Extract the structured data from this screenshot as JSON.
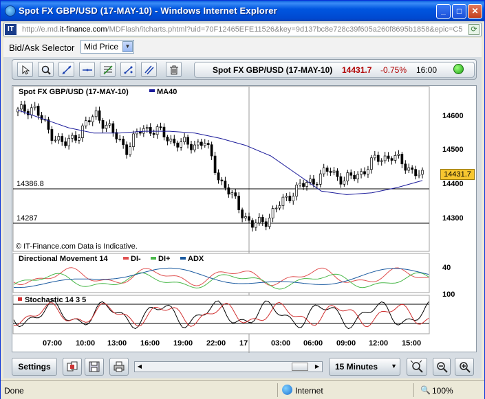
{
  "window": {
    "title": "Spot FX GBP/USD (17-MAY-10) - Windows Internet Explorer",
    "address_host_prefix": "http://e.md.",
    "address_host": "it-finance.com",
    "address_rest": "/MDFlash/itcharts.phtml?uid=70F12465EFE11526&key=9d137bc8e728c39f605a260f8695b1858&epic=C5.t",
    "site_icon_text": "IT"
  },
  "selector": {
    "label": "Bid/Ask Selector",
    "value": "Mid Price"
  },
  "quote": {
    "name": "Spot FX GBP/USD (17-MAY-10)",
    "price": "14431.7",
    "change": "-0.75%",
    "time": "16:00",
    "price_color": "#b00000",
    "change_color": "#b00000"
  },
  "chart": {
    "main_title": "Spot FX GBP/USD (17-MAY-10)",
    "ma_label": "MA40",
    "copyright": "© IT-Finance.com Data is Indicative.",
    "last_price_tag": "14431.7",
    "level_labels": [
      "14386.8",
      "14287"
    ],
    "price_axis_ticks": [
      "14600",
      "14500",
      "14400",
      "14300"
    ],
    "dm_title": "Directional Movement 14",
    "dm_legend": [
      "DI-",
      "DI+",
      "ADX"
    ],
    "dm_axis_ticks": [
      "40",
      "100"
    ],
    "stoch_title": "Stochastic 14 3 5",
    "time_ticks": [
      "07:00",
      "10:00",
      "13:00",
      "16:00",
      "19:00",
      "22:00",
      "17",
      "03:00",
      "06:00",
      "09:00",
      "12:00",
      "15:00"
    ],
    "colors": {
      "up": "#ffffff",
      "down": "#000000",
      "ma": "#1a1a9a",
      "di_minus": "#e05050",
      "di_plus": "#4ab84a",
      "adx": "#1a5aa0",
      "stoch_k": "#000000",
      "stoch_d": "#d03030"
    }
  },
  "chart_data": {
    "type": "line",
    "title": "Spot FX GBP/USD (17-MAY-10)",
    "series": [
      {
        "name": "MA40",
        "values": [
          14620,
          14595,
          14570,
          14555,
          14555,
          14560,
          14560,
          14555,
          14540,
          14520,
          14490,
          14440,
          14390,
          14380,
          14385,
          14400,
          14420
        ]
      }
    ],
    "close_series": [
      14615,
      14630,
      14560,
      14520,
      14560,
      14610,
      14560,
      14510,
      14570,
      14560,
      14530,
      14520,
      14530,
      14420,
      14360,
      14290,
      14310,
      14360,
      14400,
      14420,
      14450,
      14420,
      14440,
      14480,
      14490,
      14460,
      14430
    ],
    "ylim": [
      14250,
      14650
    ],
    "reference_levels": [
      14386.8,
      14287
    ]
  },
  "toolbar": {
    "tools": [
      "pointer-icon",
      "zoom-icon",
      "trendline-icon",
      "horizontal-line-icon",
      "fibonacci-icon",
      "channel-icon",
      "parallel-lines-icon",
      "trash-icon"
    ]
  },
  "bottom": {
    "settings_label": "Settings",
    "interval": "15 Minutes"
  },
  "status": {
    "done": "Done",
    "zone": "Internet",
    "zoom": "100%"
  }
}
